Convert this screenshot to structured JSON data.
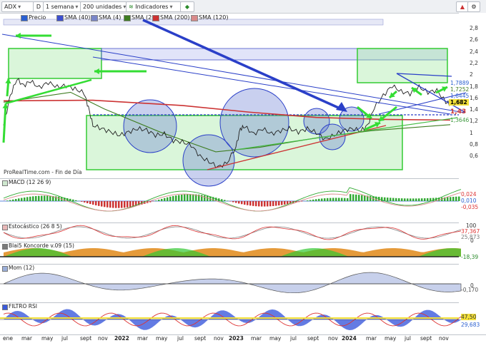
{
  "toolbar": {
    "symbol": "ADX",
    "d_label": "D",
    "period": "1 semana",
    "units": "200 unidades",
    "indicators": "Indicadores",
    "legend": [
      {
        "label": "Precio",
        "color": "#2a5fd0"
      },
      {
        "label": "SMA (40)",
        "color": "#3d4fcf"
      },
      {
        "label": "SMA (4)",
        "color": "#7a86c8"
      },
      {
        "label": "SMA (20)",
        "color": "#3f7d22"
      },
      {
        "label": "SMA (200)",
        "color": "#cc3333"
      },
      {
        "label": "SMA (120)",
        "color": "#d88a8a"
      }
    ]
  },
  "watermark": "ProRealTime.com - Fin de Día",
  "panels": {
    "macd": "MACD (12 26 9)",
    "stoch": "Estocástico (26 8 5)",
    "blai5": "Blai5 Koncorde v.09 (15)",
    "mom": "Mom (12)",
    "rsi": "FILTRO RSI"
  },
  "price_axis": [
    "2,8",
    "2,6",
    "2,4",
    "2,2",
    "2",
    "1,8",
    "1,6",
    "1,4",
    "1,2",
    "1",
    "0,8",
    "0,6"
  ],
  "price_tags": {
    "a": "1,7889",
    "b": "1,7252",
    "c": "1,6445",
    "last": "1,682",
    "d": "1,43",
    "e": "1,3646"
  },
  "indicator_axis": {
    "macd": [
      "0,024",
      "0,010",
      "-0,035"
    ],
    "stoch": [
      "100",
      "37,367",
      "25,873",
      "0"
    ],
    "blai5": [
      "-18,39"
    ],
    "mom": [
      "0",
      "-0,170"
    ],
    "rsi": [
      "47,50",
      "29,683"
    ]
  },
  "x_labels": [
    {
      "t": "ene",
      "x": 4,
      "year": false
    },
    {
      "t": "mar",
      "x": 30,
      "year": false
    },
    {
      "t": "may",
      "x": 58,
      "year": false
    },
    {
      "t": "jul",
      "x": 86,
      "year": false
    },
    {
      "t": "sept",
      "x": 112,
      "year": false
    },
    {
      "t": "nov",
      "x": 137,
      "year": false
    },
    {
      "t": "2022",
      "x": 160,
      "year": true
    },
    {
      "t": "mar",
      "x": 192,
      "year": false
    },
    {
      "t": "may",
      "x": 218,
      "year": false
    },
    {
      "t": "jul",
      "x": 248,
      "year": false
    },
    {
      "t": "sept",
      "x": 272,
      "year": false
    },
    {
      "t": "nov",
      "x": 299,
      "year": false
    },
    {
      "t": "2023",
      "x": 320,
      "year": true
    },
    {
      "t": "mar",
      "x": 351,
      "year": false
    },
    {
      "t": "may",
      "x": 377,
      "year": false
    },
    {
      "t": "jul",
      "x": 406,
      "year": false
    },
    {
      "t": "sept",
      "x": 430,
      "year": false
    },
    {
      "t": "nov",
      "x": 459,
      "year": false
    },
    {
      "t": "2024",
      "x": 478,
      "year": true
    },
    {
      "t": "mar",
      "x": 512,
      "year": false
    },
    {
      "t": "may",
      "x": 538,
      "year": false
    },
    {
      "t": "jul",
      "x": 566,
      "year": false
    },
    {
      "t": "sept",
      "x": 588,
      "year": false
    },
    {
      "t": "nov",
      "x": 614,
      "year": false
    }
  ],
  "chart_data": {
    "type": "line",
    "y_range": [
      0.55,
      2.9
    ],
    "x_range": [
      0,
      200
    ],
    "price": [
      {
        "x": 0,
        "y": 1.35
      },
      {
        "x": 3,
        "y": 1.8
      },
      {
        "x": 6,
        "y": 2.05
      },
      {
        "x": 9,
        "y": 1.95
      },
      {
        "x": 12,
        "y": 2.02
      },
      {
        "x": 16,
        "y": 1.92
      },
      {
        "x": 20,
        "y": 2.0
      },
      {
        "x": 24,
        "y": 1.93
      },
      {
        "x": 28,
        "y": 1.95
      },
      {
        "x": 32,
        "y": 1.9
      },
      {
        "x": 36,
        "y": 1.84
      },
      {
        "x": 38,
        "y": 1.62
      },
      {
        "x": 40,
        "y": 1.35
      },
      {
        "x": 44,
        "y": 1.3
      },
      {
        "x": 48,
        "y": 1.25
      },
      {
        "x": 52,
        "y": 1.2
      },
      {
        "x": 56,
        "y": 1.25
      },
      {
        "x": 60,
        "y": 1.3
      },
      {
        "x": 64,
        "y": 1.28
      },
      {
        "x": 68,
        "y": 1.2
      },
      {
        "x": 72,
        "y": 1.22
      },
      {
        "x": 76,
        "y": 1.12
      },
      {
        "x": 80,
        "y": 1.1
      },
      {
        "x": 84,
        "y": 1.05
      },
      {
        "x": 88,
        "y": 0.88
      },
      {
        "x": 92,
        "y": 0.8
      },
      {
        "x": 96,
        "y": 0.72
      },
      {
        "x": 100,
        "y": 0.78
      },
      {
        "x": 104,
        "y": 1.02
      },
      {
        "x": 106,
        "y": 1.3
      },
      {
        "x": 108,
        "y": 1.33
      },
      {
        "x": 112,
        "y": 1.22
      },
      {
        "x": 116,
        "y": 1.3
      },
      {
        "x": 120,
        "y": 1.22
      },
      {
        "x": 124,
        "y": 1.27
      },
      {
        "x": 128,
        "y": 1.3
      },
      {
        "x": 132,
        "y": 1.25
      },
      {
        "x": 136,
        "y": 1.3
      },
      {
        "x": 140,
        "y": 1.24
      },
      {
        "x": 144,
        "y": 1.14
      },
      {
        "x": 148,
        "y": 1.2
      },
      {
        "x": 152,
        "y": 1.27
      },
      {
        "x": 156,
        "y": 1.3
      },
      {
        "x": 160,
        "y": 1.27
      },
      {
        "x": 163,
        "y": 1.35
      },
      {
        "x": 166,
        "y": 1.62
      },
      {
        "x": 170,
        "y": 1.8
      },
      {
        "x": 174,
        "y": 1.95
      },
      {
        "x": 178,
        "y": 1.86
      },
      {
        "x": 182,
        "y": 1.83
      },
      {
        "x": 186,
        "y": 1.93
      },
      {
        "x": 190,
        "y": 1.85
      },
      {
        "x": 194,
        "y": 1.88
      },
      {
        "x": 198,
        "y": 1.7
      },
      {
        "x": 200,
        "y": 1.68
      }
    ],
    "sma_long_red": [
      {
        "x": 0,
        "y": 1.72
      },
      {
        "x": 40,
        "y": 1.73
      },
      {
        "x": 80,
        "y": 1.65
      },
      {
        "x": 110,
        "y": 1.55
      },
      {
        "x": 140,
        "y": 1.47
      },
      {
        "x": 170,
        "y": 1.44
      },
      {
        "x": 200,
        "y": 1.43
      }
    ],
    "sma_mid_green": [
      {
        "x": 0,
        "y": 1.7
      },
      {
        "x": 30,
        "y": 1.85
      },
      {
        "x": 45,
        "y": 1.6
      },
      {
        "x": 70,
        "y": 1.25
      },
      {
        "x": 95,
        "y": 0.95
      },
      {
        "x": 115,
        "y": 1.02
      },
      {
        "x": 140,
        "y": 1.16
      },
      {
        "x": 165,
        "y": 1.27
      },
      {
        "x": 200,
        "y": 1.36
      }
    ]
  }
}
